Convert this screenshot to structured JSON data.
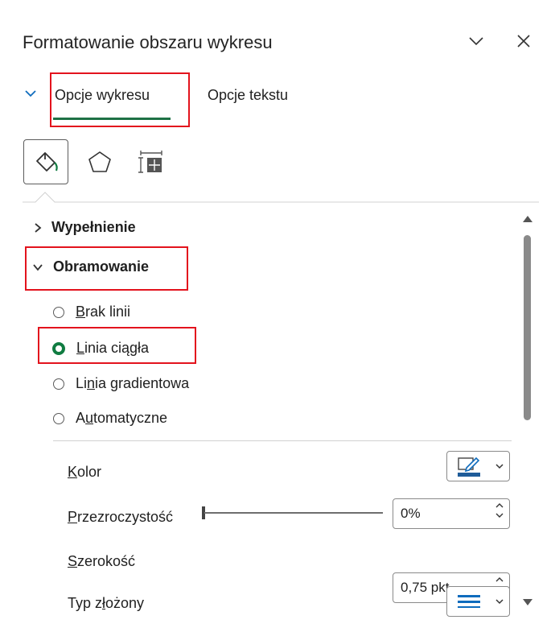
{
  "pane": {
    "title": "Formatowanie obszaru wykresu",
    "collapse_icon": "chevron-down-icon",
    "close_icon": "close-icon"
  },
  "tabs": [
    {
      "label": "Opcje wykresu",
      "selected": true
    },
    {
      "label": "Opcje tekstu",
      "selected": false
    }
  ],
  "icon_tabs": [
    {
      "name": "fill-line-icon",
      "selected": true
    },
    {
      "name": "effects-pentagon-icon",
      "selected": false
    },
    {
      "name": "size-properties-icon",
      "selected": false
    }
  ],
  "sections": {
    "fill": {
      "label": "Wypełnienie",
      "expanded": false
    },
    "border": {
      "label": "Obramowanie",
      "expanded": true
    }
  },
  "border_options": [
    {
      "pre": "",
      "key": "B",
      "post": "rak linii",
      "selected": false
    },
    {
      "pre": "",
      "key": "L",
      "post": "inia ciągła",
      "selected": true
    },
    {
      "pre": "Li",
      "key": "n",
      "post": "ia gradientowa",
      "selected": false
    },
    {
      "pre": "A",
      "key": "u",
      "post": "tomatyczne",
      "selected": false
    }
  ],
  "properties": {
    "color": {
      "key": "K",
      "rest": "olor",
      "color_swatch": "#1f5c99"
    },
    "transparency": {
      "key": "P",
      "rest": "rzezroczystość",
      "value": "0%",
      "level": 0
    },
    "width": {
      "key": "S",
      "rest": "zerokość",
      "value": "0,75 pkt"
    },
    "compound": {
      "pre": "Typ z",
      "key": "ł",
      "post": "ożony"
    }
  },
  "colors": {
    "accent_green": "#107c41",
    "highlight_red": "#e3131d",
    "tab_blue": "#0f6cbd"
  }
}
